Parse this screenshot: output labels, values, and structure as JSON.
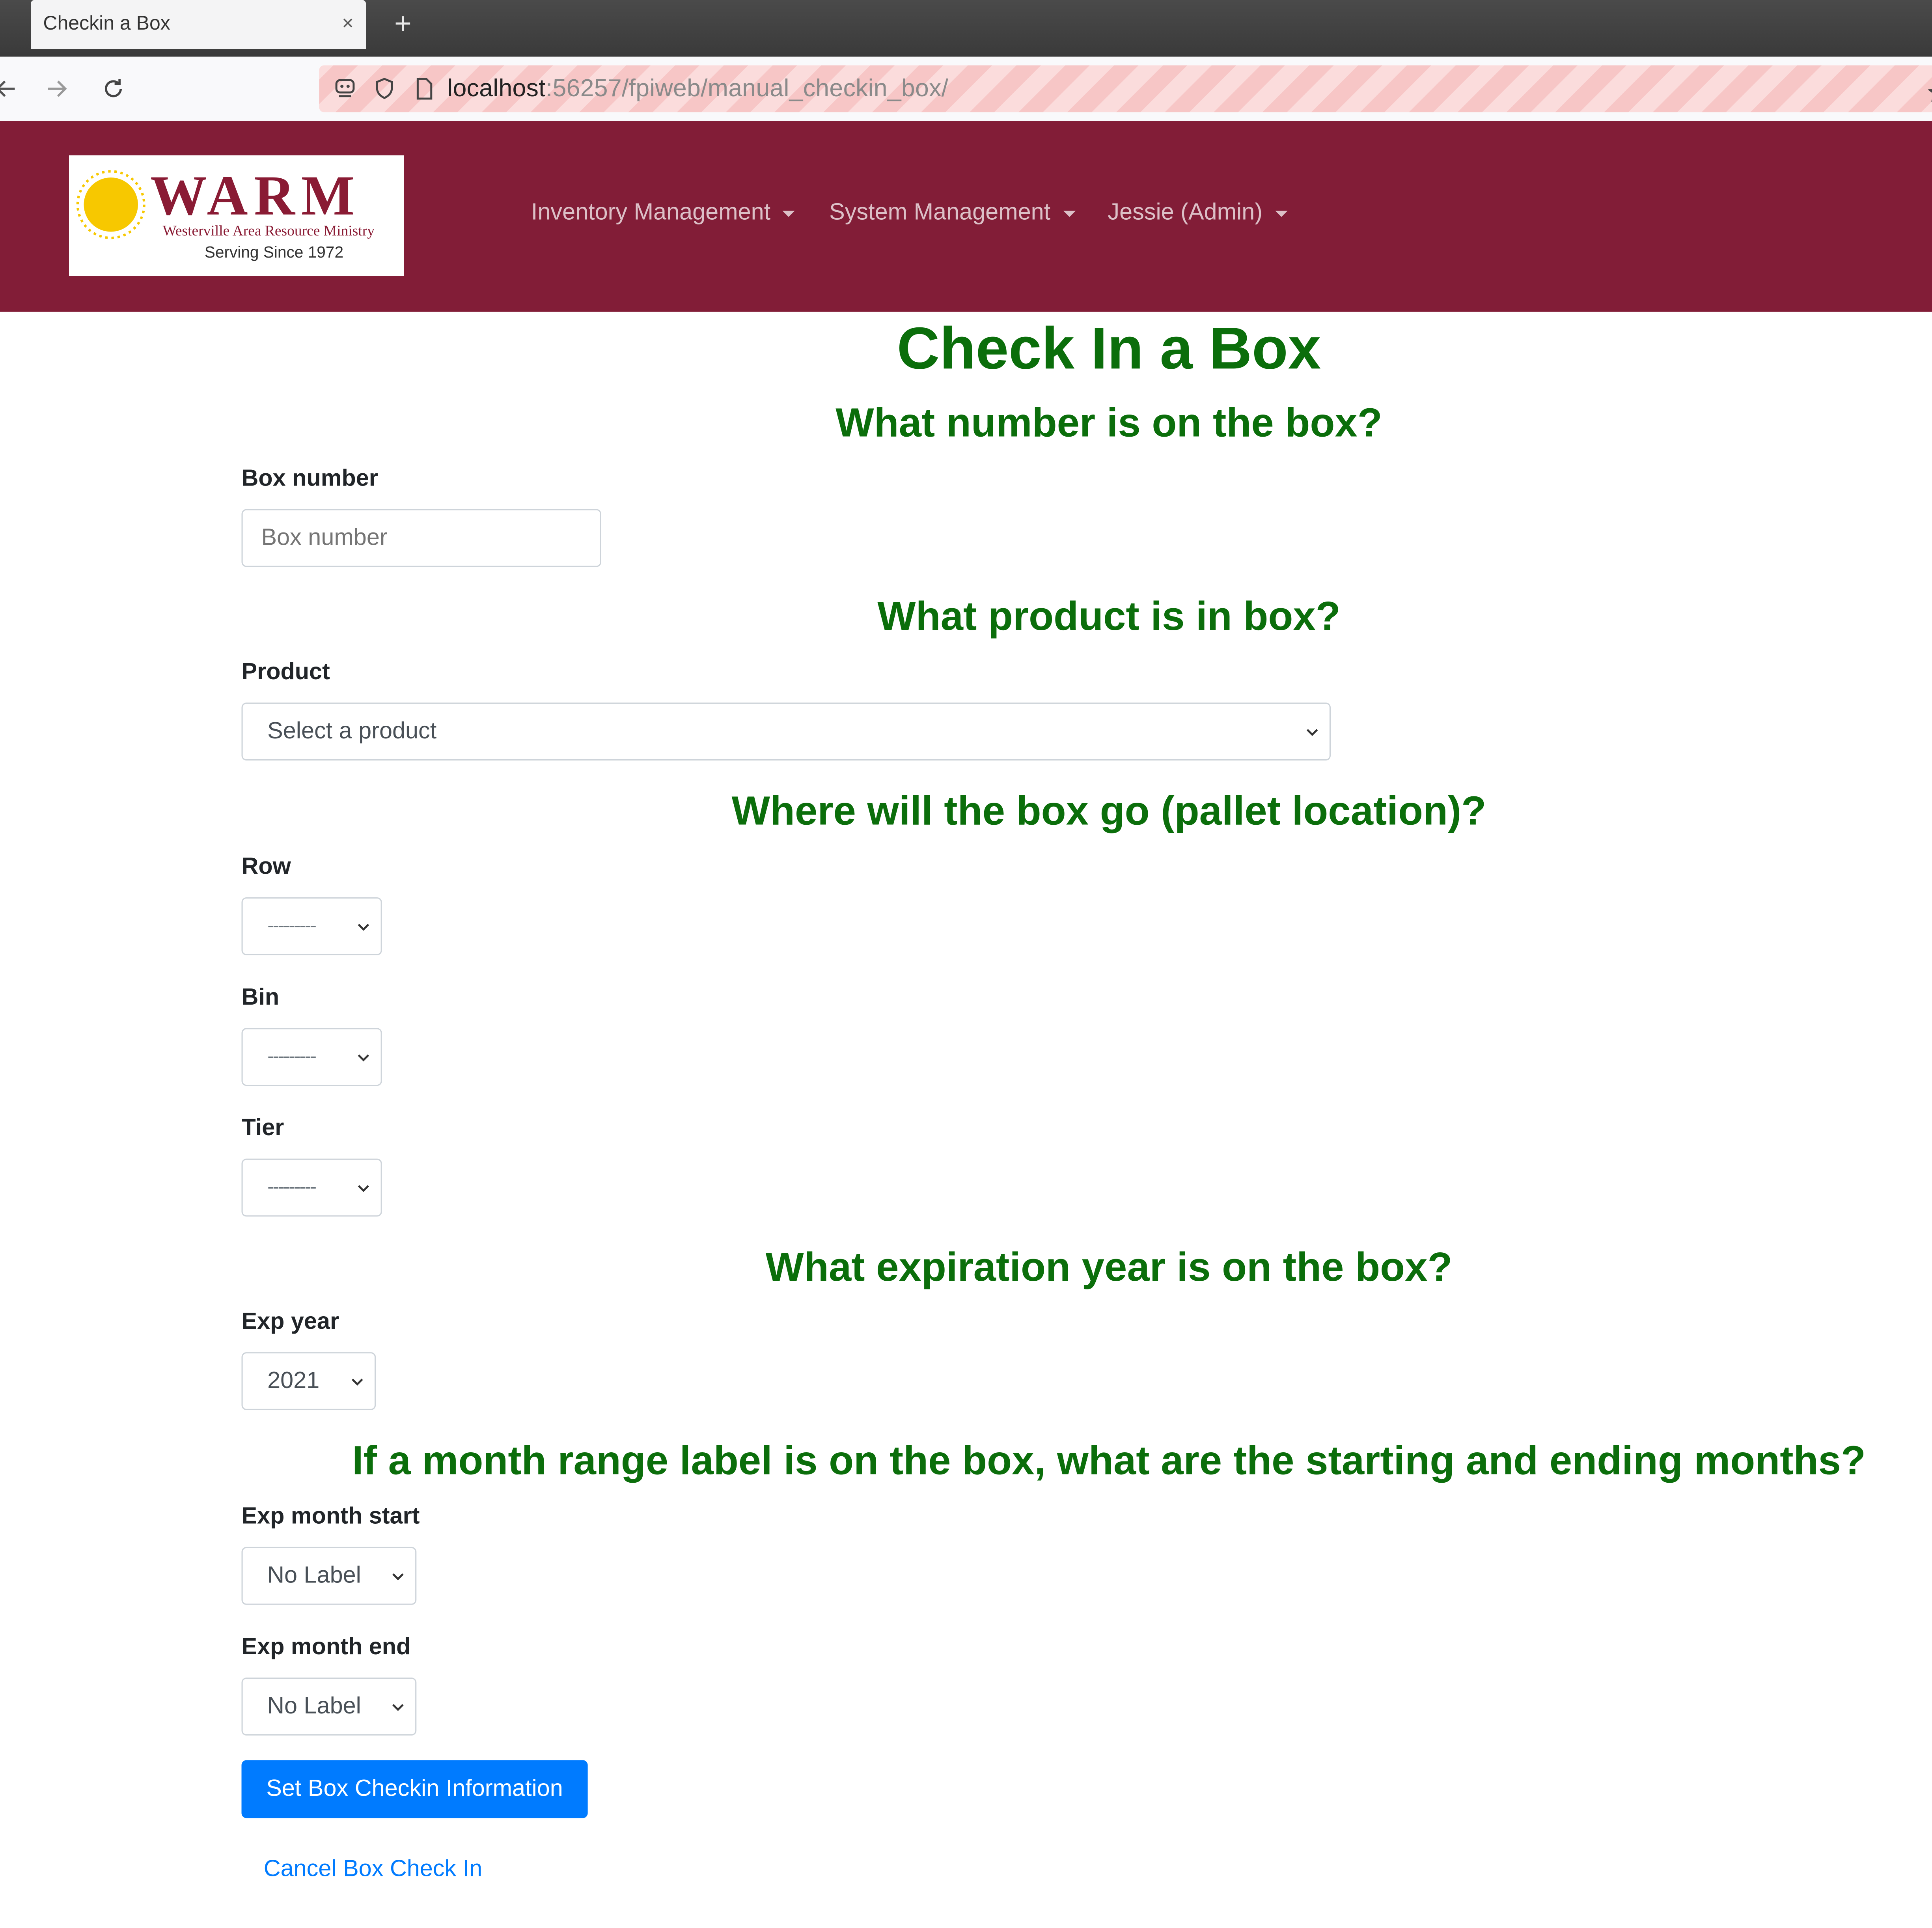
{
  "browser": {
    "tab_title": "Checkin a Box",
    "tab_close": "×",
    "new_tab": "+",
    "url_host": "localhost",
    "url_rest": ":56257/fpiweb/manual_checkin_box/"
  },
  "header": {
    "logo": {
      "title": "WARM",
      "subtitle": "Westerville Area Resource Ministry",
      "since": "Serving Since 1972"
    },
    "menus": [
      {
        "label": "Inventory Management"
      },
      {
        "label": "System Management"
      },
      {
        "label": "Jessie (Admin)"
      }
    ],
    "color": "#821d37"
  },
  "page": {
    "title": "Check In a Box",
    "q_number": "What number is on the box?",
    "q_product": "What product is in box?",
    "q_location": "Where will the box go (pallet location)?",
    "q_expiration": "What expiration year is on the box?",
    "q_month_range": "If a month range label is on the box, what are the starting and ending months?",
    "heading_color": "#0b6e0b"
  },
  "form": {
    "box_number_label": "Box number",
    "box_number_placeholder": "Box number",
    "box_number_value": "",
    "product_label": "Product",
    "product_selected": "Select a product",
    "row_label": "Row",
    "row_selected": "---------",
    "bin_label": "Bin",
    "bin_selected": "---------",
    "tier_label": "Tier",
    "tier_selected": "---------",
    "exp_year_label": "Exp year",
    "exp_year_selected": "2021",
    "exp_month_start_label": "Exp month start",
    "exp_month_start_selected": "No Label",
    "exp_month_end_label": "Exp month end",
    "exp_month_end_selected": "No Label",
    "submit_label": "Set Box Checkin Information",
    "cancel_label": "Cancel Box Check In",
    "primary_color": "#007bff"
  }
}
